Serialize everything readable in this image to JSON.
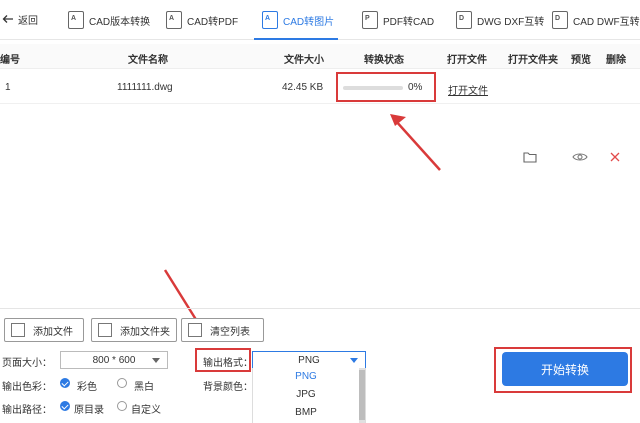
{
  "colors": {
    "accent": "#2d7ae3",
    "highlight": "#d93a3a"
  },
  "toolbar": {
    "back_label": "返回",
    "tabs": [
      {
        "label": "CAD版本转换",
        "icon": "cad-doc-icon"
      },
      {
        "label": "CAD转PDF",
        "icon": "cad-doc-icon"
      },
      {
        "label": "CAD转图片",
        "icon": "cad-doc-icon",
        "active": true
      },
      {
        "label": "PDF转CAD",
        "icon": "pdf-doc-icon"
      },
      {
        "label": "DWG DXF互转",
        "icon": "dwg-doc-icon"
      },
      {
        "label": "CAD DWF互转",
        "icon": "dwf-doc-icon"
      }
    ]
  },
  "table": {
    "headers": [
      "编号",
      "文件名称",
      "文件大小",
      "转换状态",
      "打开文件",
      "打开文件夹",
      "预览",
      "删除"
    ],
    "rows": [
      {
        "index": "1",
        "name": "1111111.dwg",
        "size": "42.45 KB",
        "progress_text": "0%",
        "progress": 0,
        "open_file": "打开文件"
      }
    ]
  },
  "actions": {
    "add_file": "添加文件",
    "add_folder": "添加文件夹",
    "clear_list": "清空列表"
  },
  "settings": {
    "page_size_label": "页面大小：",
    "page_size_value": "800 * 600",
    "output_format_label": "输出格式：",
    "output_format_value": "PNG",
    "format_options": [
      "PNG",
      "JPG",
      "BMP"
    ],
    "output_color_label": "输出色彩：",
    "color_options": [
      "彩色",
      "黑白"
    ],
    "background_label": "背景颜色：",
    "output_path_label": "输出路径：",
    "path_options": [
      "原目录",
      "自定义"
    ]
  },
  "start_button": "开始转换"
}
